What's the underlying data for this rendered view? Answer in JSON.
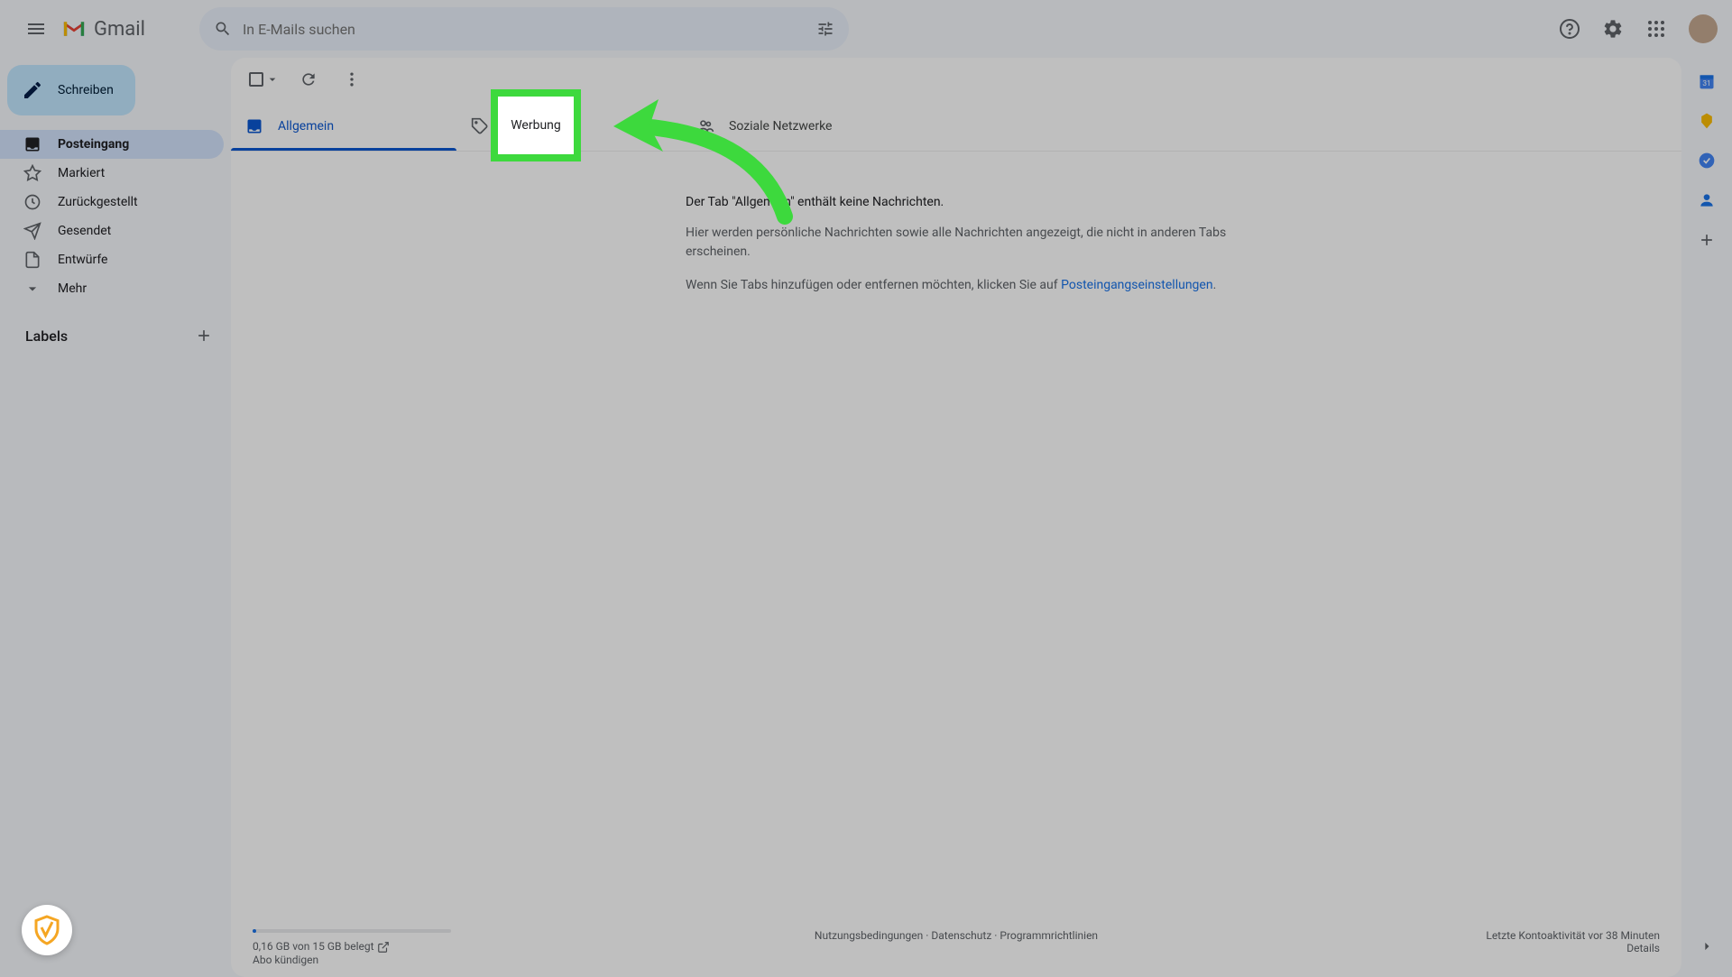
{
  "header": {
    "app_name": "Gmail",
    "search_placeholder": "In E-Mails suchen"
  },
  "sidebar": {
    "compose_label": "Schreiben",
    "items": [
      {
        "label": "Posteingang",
        "icon": "inbox"
      },
      {
        "label": "Markiert",
        "icon": "star"
      },
      {
        "label": "Zurückgestellt",
        "icon": "clock"
      },
      {
        "label": "Gesendet",
        "icon": "send"
      },
      {
        "label": "Entwürfe",
        "icon": "draft"
      },
      {
        "label": "Mehr",
        "icon": "expand"
      }
    ],
    "labels_title": "Labels"
  },
  "tabs": [
    {
      "label": "Allgemein",
      "icon": "inbox",
      "active": true
    },
    {
      "label": "Werbung",
      "icon": "tag",
      "active": false
    },
    {
      "label": "Soziale Netzwerke",
      "icon": "people",
      "active": false
    }
  ],
  "empty": {
    "title": "Der Tab \"Allgemein\" enthält keine Nachrichten.",
    "desc": "Hier werden persönliche Nachrichten sowie alle Nachrichten angezeigt, die nicht in anderen Tabs erscheinen.",
    "hint_prefix": "Wenn Sie Tabs hinzufügen oder entfernen möchten, klicken Sie auf ",
    "settings_link": "Posteingangseinstellungen",
    "period": "."
  },
  "footer": {
    "storage_text": "0,16 GB von 15 GB belegt",
    "cancel_sub": "Abo kündigen",
    "terms": "Nutzungsbedingungen",
    "privacy": "Datenschutz",
    "policies": "Programmrichtlinien",
    "activity": "Letzte Kontoaktivität vor 38 Minuten",
    "details": "Details",
    "separator": " · "
  },
  "annotation": {
    "highlight_label": "Werbung",
    "arrow_color": "#3dd93d"
  }
}
